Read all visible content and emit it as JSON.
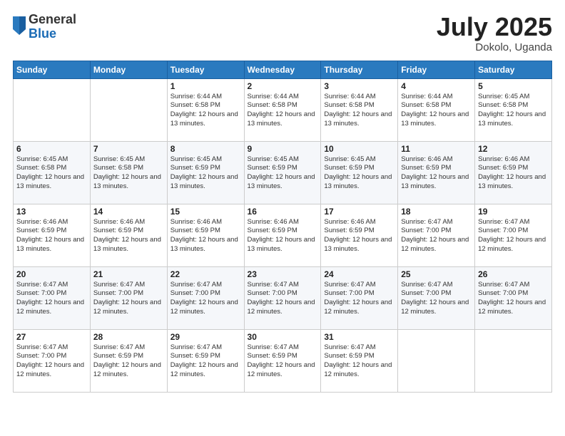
{
  "header": {
    "logo": {
      "general": "General",
      "blue": "Blue"
    },
    "title": "July 2025",
    "location": "Dokolo, Uganda"
  },
  "weekdays": [
    "Sunday",
    "Monday",
    "Tuesday",
    "Wednesday",
    "Thursday",
    "Friday",
    "Saturday"
  ],
  "weeks": [
    [
      {
        "day": "",
        "info": ""
      },
      {
        "day": "",
        "info": ""
      },
      {
        "day": "1",
        "info": "Sunrise: 6:44 AM\nSunset: 6:58 PM\nDaylight: 12 hours and 13 minutes."
      },
      {
        "day": "2",
        "info": "Sunrise: 6:44 AM\nSunset: 6:58 PM\nDaylight: 12 hours and 13 minutes."
      },
      {
        "day": "3",
        "info": "Sunrise: 6:44 AM\nSunset: 6:58 PM\nDaylight: 12 hours and 13 minutes."
      },
      {
        "day": "4",
        "info": "Sunrise: 6:44 AM\nSunset: 6:58 PM\nDaylight: 12 hours and 13 minutes."
      },
      {
        "day": "5",
        "info": "Sunrise: 6:45 AM\nSunset: 6:58 PM\nDaylight: 12 hours and 13 minutes."
      }
    ],
    [
      {
        "day": "6",
        "info": "Sunrise: 6:45 AM\nSunset: 6:58 PM\nDaylight: 12 hours and 13 minutes."
      },
      {
        "day": "7",
        "info": "Sunrise: 6:45 AM\nSunset: 6:58 PM\nDaylight: 12 hours and 13 minutes."
      },
      {
        "day": "8",
        "info": "Sunrise: 6:45 AM\nSunset: 6:59 PM\nDaylight: 12 hours and 13 minutes."
      },
      {
        "day": "9",
        "info": "Sunrise: 6:45 AM\nSunset: 6:59 PM\nDaylight: 12 hours and 13 minutes."
      },
      {
        "day": "10",
        "info": "Sunrise: 6:45 AM\nSunset: 6:59 PM\nDaylight: 12 hours and 13 minutes."
      },
      {
        "day": "11",
        "info": "Sunrise: 6:46 AM\nSunset: 6:59 PM\nDaylight: 12 hours and 13 minutes."
      },
      {
        "day": "12",
        "info": "Sunrise: 6:46 AM\nSunset: 6:59 PM\nDaylight: 12 hours and 13 minutes."
      }
    ],
    [
      {
        "day": "13",
        "info": "Sunrise: 6:46 AM\nSunset: 6:59 PM\nDaylight: 12 hours and 13 minutes."
      },
      {
        "day": "14",
        "info": "Sunrise: 6:46 AM\nSunset: 6:59 PM\nDaylight: 12 hours and 13 minutes."
      },
      {
        "day": "15",
        "info": "Sunrise: 6:46 AM\nSunset: 6:59 PM\nDaylight: 12 hours and 13 minutes."
      },
      {
        "day": "16",
        "info": "Sunrise: 6:46 AM\nSunset: 6:59 PM\nDaylight: 12 hours and 13 minutes."
      },
      {
        "day": "17",
        "info": "Sunrise: 6:46 AM\nSunset: 6:59 PM\nDaylight: 12 hours and 13 minutes."
      },
      {
        "day": "18",
        "info": "Sunrise: 6:47 AM\nSunset: 7:00 PM\nDaylight: 12 hours and 12 minutes."
      },
      {
        "day": "19",
        "info": "Sunrise: 6:47 AM\nSunset: 7:00 PM\nDaylight: 12 hours and 12 minutes."
      }
    ],
    [
      {
        "day": "20",
        "info": "Sunrise: 6:47 AM\nSunset: 7:00 PM\nDaylight: 12 hours and 12 minutes."
      },
      {
        "day": "21",
        "info": "Sunrise: 6:47 AM\nSunset: 7:00 PM\nDaylight: 12 hours and 12 minutes."
      },
      {
        "day": "22",
        "info": "Sunrise: 6:47 AM\nSunset: 7:00 PM\nDaylight: 12 hours and 12 minutes."
      },
      {
        "day": "23",
        "info": "Sunrise: 6:47 AM\nSunset: 7:00 PM\nDaylight: 12 hours and 12 minutes."
      },
      {
        "day": "24",
        "info": "Sunrise: 6:47 AM\nSunset: 7:00 PM\nDaylight: 12 hours and 12 minutes."
      },
      {
        "day": "25",
        "info": "Sunrise: 6:47 AM\nSunset: 7:00 PM\nDaylight: 12 hours and 12 minutes."
      },
      {
        "day": "26",
        "info": "Sunrise: 6:47 AM\nSunset: 7:00 PM\nDaylight: 12 hours and 12 minutes."
      }
    ],
    [
      {
        "day": "27",
        "info": "Sunrise: 6:47 AM\nSunset: 7:00 PM\nDaylight: 12 hours and 12 minutes."
      },
      {
        "day": "28",
        "info": "Sunrise: 6:47 AM\nSunset: 6:59 PM\nDaylight: 12 hours and 12 minutes."
      },
      {
        "day": "29",
        "info": "Sunrise: 6:47 AM\nSunset: 6:59 PM\nDaylight: 12 hours and 12 minutes."
      },
      {
        "day": "30",
        "info": "Sunrise: 6:47 AM\nSunset: 6:59 PM\nDaylight: 12 hours and 12 minutes."
      },
      {
        "day": "31",
        "info": "Sunrise: 6:47 AM\nSunset: 6:59 PM\nDaylight: 12 hours and 12 minutes."
      },
      {
        "day": "",
        "info": ""
      },
      {
        "day": "",
        "info": ""
      }
    ]
  ]
}
